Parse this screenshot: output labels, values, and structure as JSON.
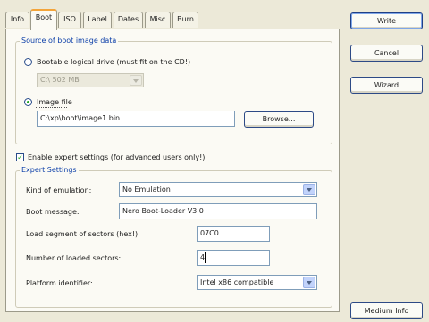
{
  "tabs": [
    {
      "label": "Info"
    },
    {
      "label": "Boot"
    },
    {
      "label": "ISO"
    },
    {
      "label": "Label"
    },
    {
      "label": "Dates"
    },
    {
      "label": "Misc"
    },
    {
      "label": "Burn"
    }
  ],
  "active_tab": "Boot",
  "source_group": {
    "title": "Source of boot image data",
    "bootable_drive_label": "Bootable logical drive (must fit on the CD!)",
    "bootable_drive_selected": false,
    "drive_value": "C:\\  502 MB",
    "image_file_label": "Image file",
    "image_file_selected": true,
    "image_file_value": "C:\\xp\\boot\\image1.bin",
    "browse_label": "Browse..."
  },
  "expert_toggle": {
    "label": "Enable expert settings (for advanced users only!)",
    "checked": true,
    "check_glyph": "✓"
  },
  "expert_group": {
    "title": "Expert Settings",
    "emulation_label": "Kind of emulation:",
    "emulation_value": "No Emulation",
    "boot_message_label": "Boot message:",
    "boot_message_value": "Nero Boot-Loader V3.0",
    "load_segment_label": "Load segment of sectors (hex!):",
    "load_segment_value": "07C0",
    "loaded_sectors_label": "Number of loaded sectors:",
    "loaded_sectors_value": "4",
    "platform_label": "Platform identifier:",
    "platform_value": "Intel x86 compatible"
  },
  "side_buttons": {
    "write": "Write",
    "cancel": "Cancel",
    "wizard": "Wizard",
    "medium_info": "Medium Info"
  },
  "colors": {
    "dialog_bg": "#ece9d8",
    "panel_bg": "#fbfaf4",
    "group_title": "#0b3ea8",
    "active_tab_accent": "#f3a43a",
    "check_green": "#23a823"
  }
}
